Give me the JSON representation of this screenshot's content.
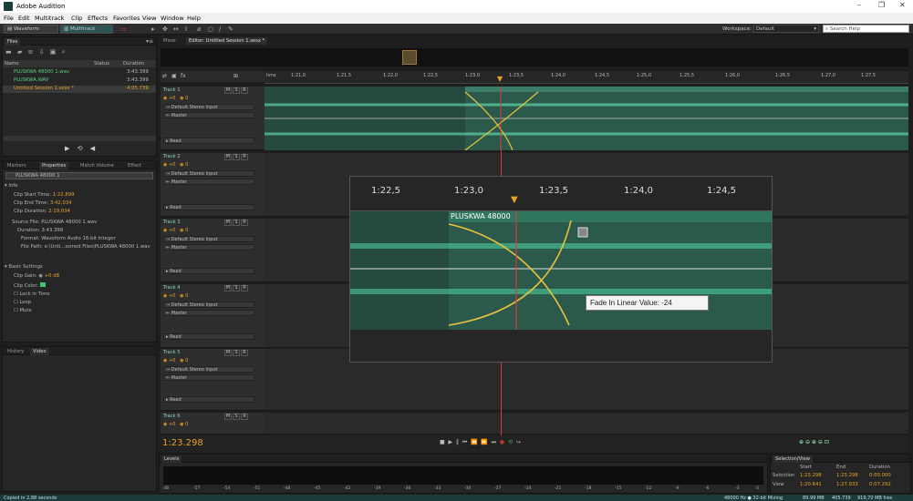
{
  "window": {
    "title": "Adobe Audition",
    "minimize": "–",
    "restore": "❐",
    "close": "✕"
  },
  "menu": [
    "File",
    "Edit",
    "Multitrack",
    "Clip",
    "Effects",
    "Favorites",
    "View",
    "Window",
    "Help"
  ],
  "toolbar": {
    "waveform_label": "Waveform",
    "multitrack_label": "Multitrack",
    "workspace_label": "Workspace:",
    "workspace_value": "Default",
    "search_placeholder": "Search Help"
  },
  "files_panel": {
    "tab": "Files",
    "col_name": "Name",
    "col_status": "Status",
    "col_duration": "Duration",
    "items": [
      {
        "name": "PLUSKWA 48000 1.wav",
        "duration": "3:43.399"
      },
      {
        "name": "PLUSKWA.WAV",
        "duration": "3:43.399"
      },
      {
        "name": "Untitled Session 1.sesx *",
        "duration": "4:05.739"
      }
    ]
  },
  "properties_panel": {
    "tabs": [
      "Markers",
      "Properties",
      "Match Volume",
      "Effect"
    ],
    "clip_name": "PLUSKWA 48000 1",
    "info_header": "Info",
    "clip_start_label": "Clip Start Time:",
    "clip_start": "1:22,899",
    "clip_end_label": "Clip End Time:",
    "clip_end": "3:42,034",
    "clip_duration_label": "Clip Duration:",
    "clip_duration": "2:19,034",
    "source_file": "Source File: PLUSKWA 48000 1.wav",
    "duration": "Duration: 3:43.399",
    "format": "Format: Waveform Audio 16-bit Integer",
    "file_path": "File Path: e:\\Unti...ssmed Files\\PLUSKWA 48000 1.wav",
    "basic_header": "Basic Settings",
    "clip_gain_label": "Clip Gain:",
    "clip_gain_value": "+0 dB",
    "clip_color_label": "Clip Color:",
    "lock_in_time": "Lock in Time",
    "loop": "Loop",
    "mute": "Mute"
  },
  "history_panel": {
    "tabs": [
      "History",
      "Video"
    ]
  },
  "editor": {
    "tabs": [
      "Mixer",
      "Editor: Untitled Session 1.sesx *"
    ],
    "ruler_unit": "hms",
    "ruler_labels": [
      "1:21,0",
      "1:21,5",
      "1:22,0",
      "1:22,5",
      "1:23,0",
      "1:23,5",
      "1:24,0",
      "1:24,5",
      "1:25,0",
      "1:25,5",
      "1:26,0",
      "1:26,5",
      "1:27,0",
      "1:27,5"
    ],
    "time": "1:23.298",
    "tracks": [
      {
        "name": "Track 1",
        "vol": "+0",
        "pan": "0",
        "input": "Default Stereo Input",
        "output": "Master",
        "mode": "Read"
      },
      {
        "name": "Track 2",
        "vol": "+0",
        "pan": "0",
        "input": "Default Stereo Input",
        "output": "Master",
        "mode": "Read"
      },
      {
        "name": "Track 3",
        "vol": "+0",
        "pan": "0",
        "input": "Default Stereo Input",
        "output": "Master",
        "mode": "Read"
      },
      {
        "name": "Track 4",
        "vol": "+0",
        "pan": "0",
        "input": "Default Stereo Input",
        "output": "Master",
        "mode": "Read"
      },
      {
        "name": "Track 5",
        "vol": "+0",
        "pan": "0",
        "input": "Default Stereo Input",
        "output": "Master",
        "mode": "Read"
      },
      {
        "name": "Track 6",
        "vol": "+0",
        "pan": "0"
      }
    ],
    "clip_label": "PLUSKWA 48000"
  },
  "zoom": {
    "ruler_labels": [
      "1:22,5",
      "1:23,0",
      "1:23,5",
      "1:24,0",
      "1:24,5"
    ],
    "clip_label": "PLUSKWA 48000",
    "tooltip": "Fade In Linear Value: -24"
  },
  "levels": {
    "tab": "Levels",
    "scale": [
      "dB",
      "-57",
      "-54",
      "-51",
      "-48",
      "-45",
      "-42",
      "-39",
      "-36",
      "-33",
      "-30",
      "-27",
      "-24",
      "-21",
      "-18",
      "-15",
      "-12",
      "-9",
      "-6",
      "-3",
      "0"
    ]
  },
  "selection": {
    "tab": "Selection/View",
    "col_start": "Start",
    "col_end": "End",
    "col_duration": "Duration",
    "selection_label": "Selection",
    "sel_start": "1:23.298",
    "sel_end": "1:23.298",
    "sel_dur": "0:00.000",
    "view_label": "View",
    "view_start": "1:20.641",
    "view_end": "1:27.933",
    "view_dur": "0:07.292"
  },
  "status": {
    "left": "Copied in 2,88 seconds",
    "format": "48000 Hz ● 32-bit Mixing",
    "mem": "89.99 MB",
    "dur": "405.739",
    "free": "919,70 MB free"
  },
  "colors": {
    "accent": "#e8a227",
    "wave": "#4fd6a3",
    "clip_bg": "#2f6f5c",
    "playhead": "#d93a3a",
    "status_bg": "#1b3c3a"
  }
}
